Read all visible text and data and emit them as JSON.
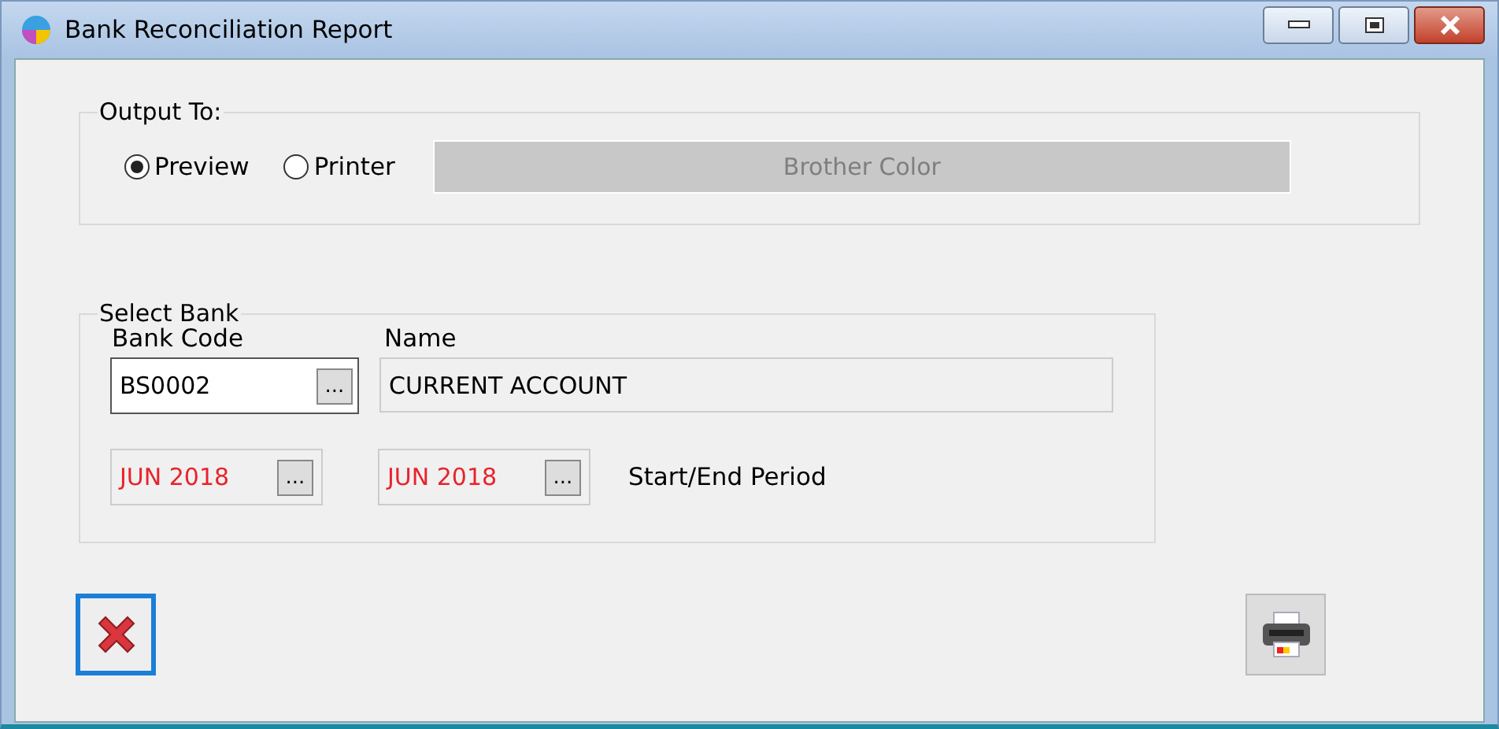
{
  "window": {
    "title": "Bank Reconciliation Report"
  },
  "output_group": {
    "legend": "Output To:",
    "options": [
      {
        "label": "Preview",
        "selected": true
      },
      {
        "label": "Printer",
        "selected": false
      }
    ],
    "printer_field": {
      "value": "Brother Color",
      "disabled": true
    }
  },
  "bank_group": {
    "legend": "Select Bank",
    "bank_code": {
      "label": "Bank Code",
      "value": "BS0002",
      "button": "..."
    },
    "name": {
      "label": "Name",
      "value": "CURRENT ACCOUNT"
    },
    "periods": [
      {
        "value": "JUN 2018",
        "button": "..."
      },
      {
        "value": "JUN 2018",
        "button": "..."
      }
    ],
    "period_label": "Start/End Period"
  },
  "buttons": [
    {
      "kind": "cancel",
      "focused": true
    },
    {
      "kind": "print",
      "focused": false
    }
  ]
}
